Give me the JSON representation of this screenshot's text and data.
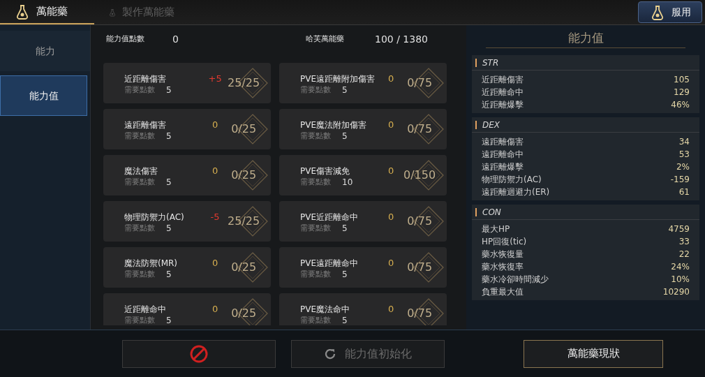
{
  "tabs": [
    {
      "label": "萬能藥",
      "selected": true
    },
    {
      "label": "製作萬能藥",
      "selected": false
    }
  ],
  "use_button": "服用",
  "sidebar": {
    "items": [
      {
        "label": "能力",
        "selected": false
      },
      {
        "label": "能力值",
        "selected": true
      }
    ]
  },
  "summary": [
    {
      "label": "能力值點數",
      "value": "0"
    },
    {
      "label": "哈芙萬能藥",
      "value": "100 / 1380"
    }
  ],
  "stats": [
    {
      "name": "近距離傷害",
      "delta": "+5",
      "changed": true,
      "progress": "25/25",
      "req_label": "需要點數",
      "req": "5"
    },
    {
      "name": "PVE遠距離附加傷害",
      "delta": "0",
      "changed": false,
      "progress": "0/75",
      "req_label": "需要點數",
      "req": "5"
    },
    {
      "name": "遠距離傷害",
      "delta": "0",
      "changed": false,
      "progress": "0/25",
      "req_label": "需要點數",
      "req": "5"
    },
    {
      "name": "PVE魔法附加傷害",
      "delta": "0",
      "changed": false,
      "progress": "0/75",
      "req_label": "需要點數",
      "req": "5"
    },
    {
      "name": "魔法傷害",
      "delta": "0",
      "changed": false,
      "progress": "0/25",
      "req_label": "需要點數",
      "req": "5"
    },
    {
      "name": "PVE傷害減免",
      "delta": "0",
      "changed": false,
      "progress": "0/150",
      "req_label": "需要點數",
      "req": "10"
    },
    {
      "name": "物理防禦力(AC)",
      "delta": "-5",
      "changed": true,
      "progress": "25/25",
      "req_label": "需要點數",
      "req": "5"
    },
    {
      "name": "PVE近距離命中",
      "delta": "0",
      "changed": false,
      "progress": "0/75",
      "req_label": "需要點數",
      "req": "5"
    },
    {
      "name": "魔法防禦(MR)",
      "delta": "0",
      "changed": false,
      "progress": "0/25",
      "req_label": "需要點數",
      "req": "5"
    },
    {
      "name": "PVE遠距離命中",
      "delta": "0",
      "changed": false,
      "progress": "0/75",
      "req_label": "需要點數",
      "req": "5"
    },
    {
      "name": "近距離命中",
      "delta": "0",
      "changed": false,
      "progress": "0/25",
      "req_label": "需要點數",
      "req": "5"
    },
    {
      "name": "PVE魔法命中",
      "delta": "0",
      "changed": false,
      "progress": "0/75",
      "req_label": "需要點數",
      "req": "5"
    }
  ],
  "buttons": [
    {
      "disabled": true,
      "kind": "blocked"
    },
    {
      "label": "能力值初始化",
      "disabled": true,
      "kind": "reset"
    }
  ],
  "panel": {
    "title": "能力值",
    "sections": [
      {
        "title": "STR",
        "rows": [
          {
            "label": "近距離傷害",
            "value": "105"
          },
          {
            "label": "近距離命中",
            "value": "129"
          },
          {
            "label": "近距離爆擊",
            "value": "46%"
          }
        ]
      },
      {
        "title": "DEX",
        "rows": [
          {
            "label": "遠距離傷害",
            "value": "34"
          },
          {
            "label": "遠距離命中",
            "value": "53"
          },
          {
            "label": "遠距離爆擊",
            "value": "2%"
          },
          {
            "label": "物理防禦力(AC)",
            "value": "-159"
          },
          {
            "label": "遠距離迴避力(ER)",
            "value": "61"
          }
        ]
      },
      {
        "title": "CON",
        "rows": [
          {
            "label": "最大HP",
            "value": "4759"
          },
          {
            "label": "HP回復(tic)",
            "value": "33"
          },
          {
            "label": "藥水恢復量",
            "value": "22"
          },
          {
            "label": "藥水恢復率",
            "value": "24%"
          },
          {
            "label": "藥水冷卻時間減少",
            "value": "10%"
          },
          {
            "label": "負重最大值",
            "value": "10290"
          }
        ]
      }
    ],
    "button": "萬能藥現狀"
  }
}
